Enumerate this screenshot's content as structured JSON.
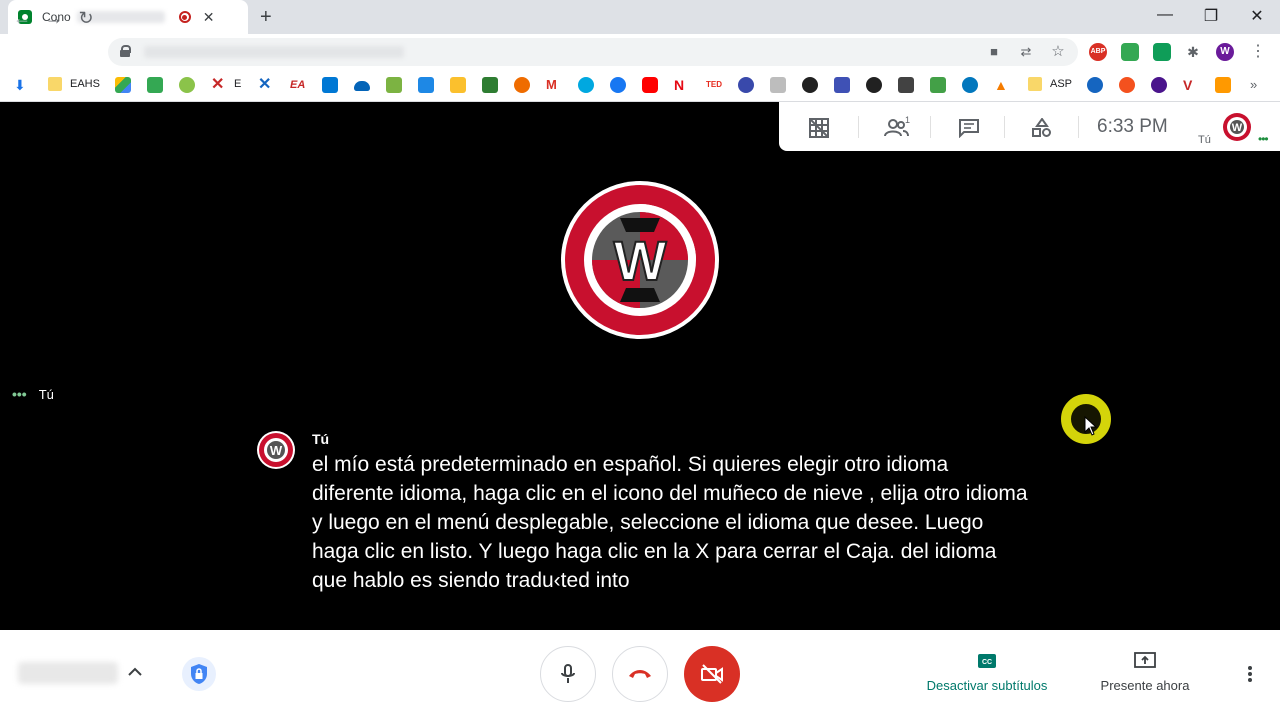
{
  "browser": {
    "tab_title": "Cono",
    "new_tab_label": "+",
    "window_controls": [
      "—",
      "❐",
      "✕"
    ]
  },
  "bookmarks": {
    "eahs": "EAHS",
    "e": "E",
    "asp": "ASP"
  },
  "meet": {
    "time": "6:33  PM",
    "self_name_top": "Tú",
    "self_tile_label": "Tú",
    "caption_speaker": "Tú",
    "caption_text": "el mío está predeterminado en español. Si quieres elegir otro idioma diferente idioma, haga clic en el icono del muñeco de nieve , elija otro idioma y luego en el menú desplegable, seleccione el idioma que desee. Luego haga clic en listo. Y luego haga clic en la X para cerrar el Caja. del idioma que hablo es siendo tradu‹ted into",
    "participants_count": "1",
    "captions_button": "Desactivar subtítulos",
    "present_button": "Presente ahora"
  },
  "colors": {
    "accent_green": "#00796b",
    "end_call_red": "#d93025",
    "cam_off_red": "#d93025",
    "logo_red": "#c8102e",
    "cursor_highlight": "#d4d40a"
  }
}
